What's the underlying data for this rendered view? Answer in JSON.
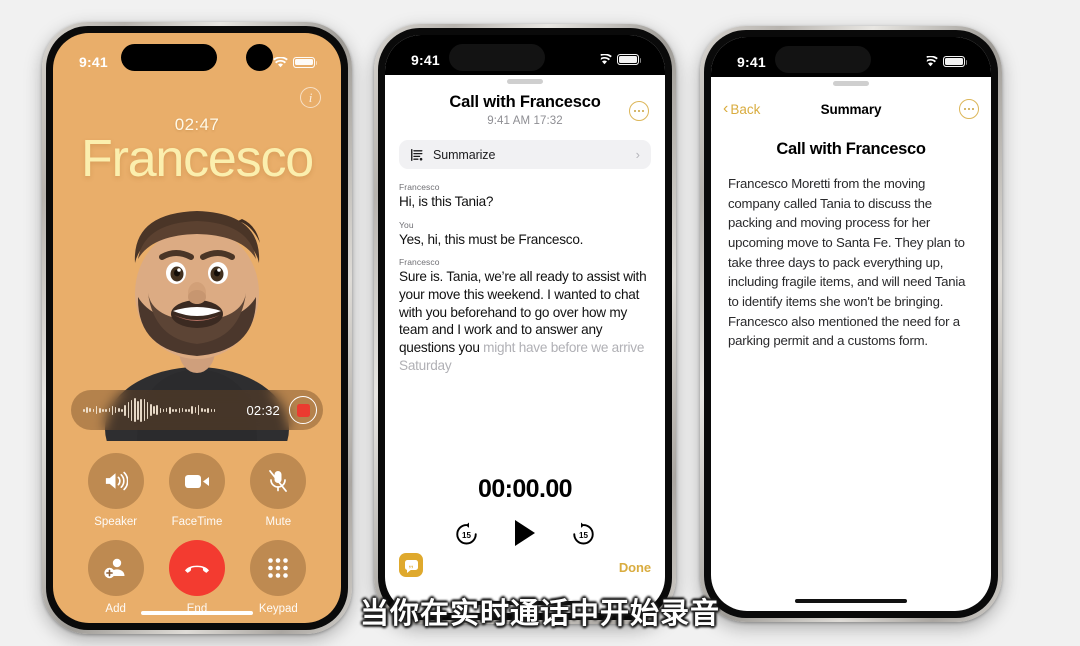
{
  "subtitle": "当你在实时通话中开始录音",
  "phone1": {
    "status": {
      "time": "9:41",
      "signal_icon": "cellular-bars-icon",
      "wifi_icon": "wifi-icon",
      "battery_icon": "battery-icon"
    },
    "info_glyph": "i",
    "call_duration": "02:47",
    "caller_name": "Francesco",
    "avatar_name": "memoji-avatar",
    "recording": {
      "time": "02:32",
      "record_icon": "record-stop-icon",
      "waveform_icon": "waveform-icon"
    },
    "controls": [
      {
        "label": "Speaker",
        "icon": "speaker-icon"
      },
      {
        "label": "FaceTime",
        "icon": "video-camera-icon"
      },
      {
        "label": "Mute",
        "icon": "microphone-muted-icon"
      },
      {
        "label": "Add",
        "icon": "add-person-icon"
      },
      {
        "label": "End",
        "icon": "end-call-icon"
      },
      {
        "label": "Keypad",
        "icon": "keypad-icon"
      }
    ]
  },
  "phone2": {
    "status": {
      "time": "9:41",
      "signal_icon": "cellular-bars-icon",
      "wifi_icon": "wifi-icon",
      "battery_icon": "battery-icon"
    },
    "title": "Call with Francesco",
    "subtitle": "9:41 AM  17:32",
    "more_icon": "ellipsis-circle-icon",
    "summarize": {
      "label": "Summarize",
      "icon": "summarize-icon",
      "chevron": "›"
    },
    "transcript": [
      {
        "speaker": "Francesco",
        "text": "Hi, is this Tania?"
      },
      {
        "speaker": "You",
        "text": "Yes, hi, this must be Francesco."
      },
      {
        "speaker": "Francesco",
        "text": "Sure is. Tania, we’re all ready to assist with your move this weekend. I wanted to chat with you beforehand to go over how my team and I work and to answer any questions you ",
        "tail": "might have before we arrive Saturday"
      }
    ],
    "player": {
      "timer": "00:00.00",
      "back_label": "15",
      "forward_label": "15",
      "play_icon": "play-icon",
      "back_icon": "skip-back-15-icon",
      "forward_icon": "skip-forward-15-icon"
    },
    "bubble_icon": "transcript-bubble-icon",
    "bubble_glyph": "\"",
    "done_label": "Done"
  },
  "phone3": {
    "status": {
      "time": "9:41",
      "signal_icon": "cellular-bars-icon",
      "wifi_icon": "wifi-icon",
      "battery_icon": "battery-icon"
    },
    "back_label": "Back",
    "back_chevron": "‹",
    "nav_title": "Summary",
    "more_icon": "ellipsis-circle-icon",
    "title": "Call with Francesco",
    "body": "Francesco Moretti from the moving company called Tania to discuss the packing and moving process for her upcoming move to Santa Fe. They plan to take three days to pack everything up, including fragile items, and will need Tania to identify items she won't be bringing. Francesco also mentioned the need for a parking permit and a customs form."
  },
  "colors": {
    "call_background": "#e9ae6a",
    "caller_name": "#fbefae",
    "accent_gold": "#d9ac3f",
    "end_call_red": "#f33b30",
    "record_red": "#eb3b30"
  }
}
